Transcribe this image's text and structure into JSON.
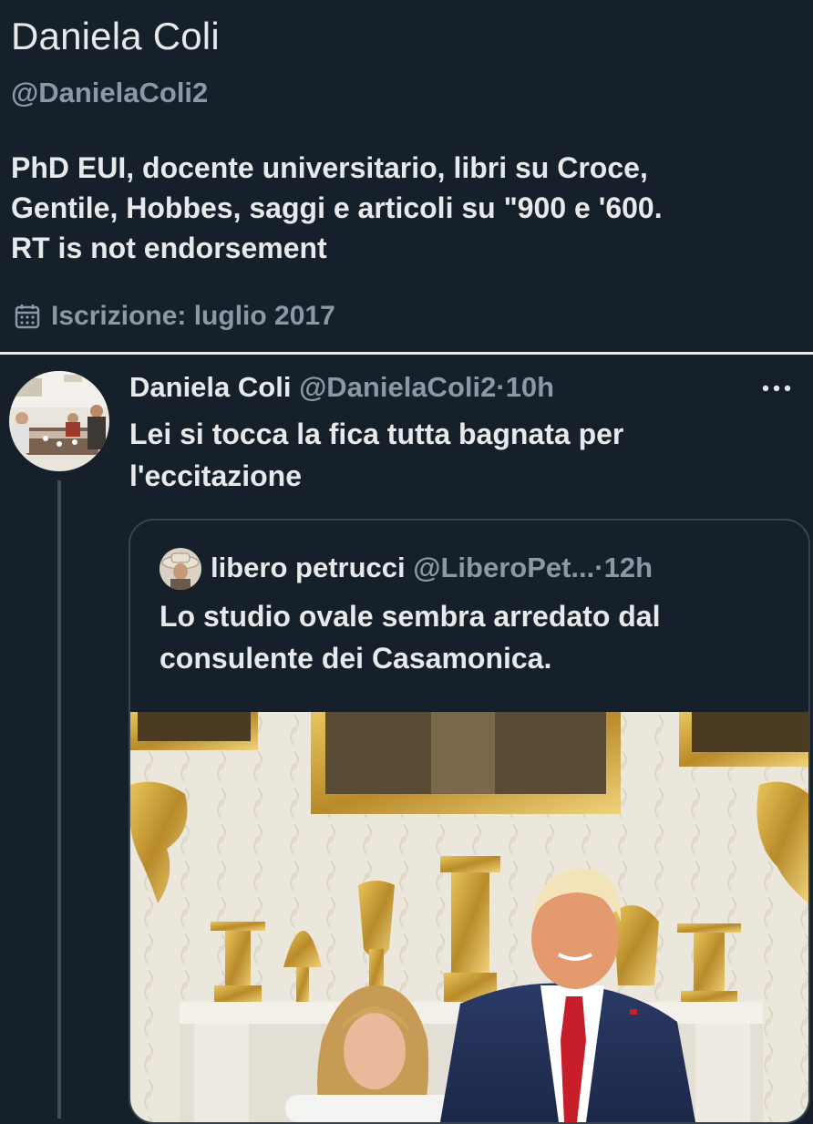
{
  "profile": {
    "display_name": "Daniela Coli",
    "handle": "@DanielaColi2",
    "bio_lines": [
      "PhD EUI, docente universitario, libri su Croce,",
      "Gentile, Hobbes, saggi e articoli su \"900 e '600.",
      "RT is not endorsement"
    ],
    "joined": "Iscrizione: luglio 2017",
    "joined_icon": "calendar-icon"
  },
  "tweet": {
    "author_name": "Daniela Coli",
    "author_handle": "@DanielaColi2",
    "separator": "·",
    "time": "10h",
    "more_icon": "more-horizontal-icon",
    "text_lines": [
      "Lei si tocca la fica tutta bagnata per",
      "l'eccitazione"
    ],
    "quote": {
      "author_name": "libero petrucci",
      "author_handle": "@LiberoPet...",
      "separator": "·",
      "time": "12h",
      "text_lines": [
        "Lo studio ovale sembra arredato dal",
        "consulente dei Casamonica."
      ]
    }
  },
  "colors": {
    "background": "#15202b",
    "text_primary": "#e7e9ea",
    "text_secondary": "#8b98a5",
    "border": "#38444d",
    "thread_line": "#3e4e5d"
  }
}
